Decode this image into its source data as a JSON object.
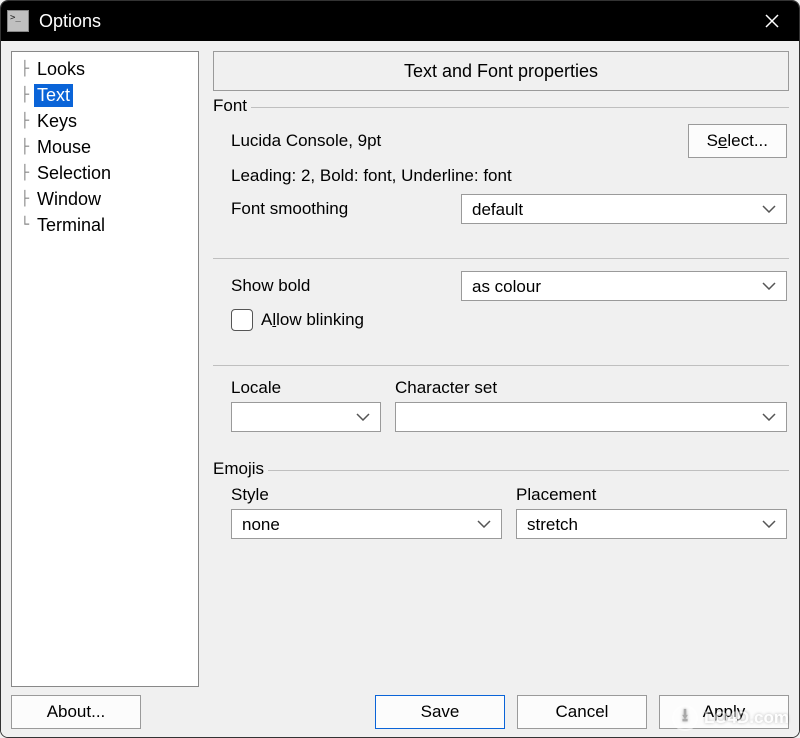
{
  "window": {
    "title": "Options"
  },
  "tree": {
    "items": [
      {
        "label": "Looks",
        "selected": false
      },
      {
        "label": "Text",
        "selected": true
      },
      {
        "label": "Keys",
        "selected": false
      },
      {
        "label": "Mouse",
        "selected": false
      },
      {
        "label": "Selection",
        "selected": false
      },
      {
        "label": "Window",
        "selected": false
      },
      {
        "label": "Terminal",
        "selected": false
      }
    ]
  },
  "content": {
    "header": "Text and Font properties",
    "font": {
      "legend": "Font",
      "current": "Lucida Console, 9pt",
      "select_btn_pre": "S",
      "select_btn_u": "e",
      "select_btn_post": "lect...",
      "leading_line": "Leading: 2, Bold: font, Underline: font",
      "smoothing_label": "Font smoothing",
      "smoothing_value": "default",
      "show_bold_label": "Show bold",
      "show_bold_value": "as colour",
      "allow_blinking_pre": "A",
      "allow_blinking_u": "l",
      "allow_blinking_post": "low blinking"
    },
    "locale": {
      "locale_label": "Locale",
      "locale_value": "",
      "charset_label": "Character set",
      "charset_value": ""
    },
    "emojis": {
      "legend": "Emojis",
      "style_label": "Style",
      "style_value": "none",
      "placement_label": "Placement",
      "placement_value": "stretch"
    }
  },
  "buttons": {
    "about": "About...",
    "save": "Save",
    "cancel": "Cancel",
    "apply": "Apply"
  },
  "watermark": "LO4D.com"
}
